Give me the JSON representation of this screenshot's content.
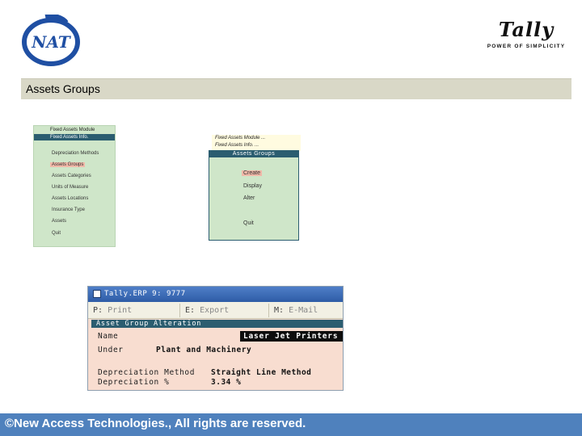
{
  "header": {
    "nat_logo_text": "NAT",
    "tally_logo_text": "Tally",
    "tally_tagline": "POWER OF SIMPLICITY"
  },
  "section_title": "Assets Groups",
  "left_menu": {
    "title": "Fixed Assets Module",
    "bar_label": "Fixed Assets Info.",
    "items": [
      {
        "label": "Depreciation Methods",
        "selected": false
      },
      {
        "label": "Assets Groups",
        "selected": true
      },
      {
        "label": "Assets Categories",
        "selected": false
      },
      {
        "label": "Units of Measure",
        "selected": false
      },
      {
        "label": "Assets Locations",
        "selected": false
      },
      {
        "label": "Insurance Type",
        "selected": false
      },
      {
        "label": "Assets",
        "selected": false
      },
      {
        "label": "Quit",
        "selected": false
      }
    ]
  },
  "mid_menu": {
    "head_lines": [
      "Fixed Assets Module ...",
      "Fixed Assets Info. ..."
    ],
    "bar_label": "Assets Groups",
    "items": [
      {
        "label": "Create",
        "selected": true
      },
      {
        "label": "Display",
        "selected": false
      },
      {
        "label": "Alter",
        "selected": false
      },
      {
        "label": "Quit",
        "selected": false
      }
    ]
  },
  "tally_window": {
    "title": "Tally.ERP 9: 9777",
    "buttons": [
      {
        "key": "P:",
        "label": "Print"
      },
      {
        "key": "E:",
        "label": "Export"
      },
      {
        "key": "M:",
        "label": "E-Mail"
      }
    ],
    "form_title": "Asset Group Alteration",
    "fields": {
      "name_label": "Name",
      "name_value": "Laser Jet Printers",
      "under_label": "Under",
      "under_value": "Plant and Machinery",
      "method_label": "Depreciation Method",
      "method_value": "Straight Line Method",
      "percent_label": "Depreciation %",
      "percent_value": "3.34 %"
    }
  },
  "footer": {
    "text": "©New Access Technologies., All rights are reserved."
  },
  "colors": {
    "title_bar": "#d9d8c7",
    "menu_bg": "#cfe6c9",
    "menu_bar": "#2b5d70",
    "selection": "#f0b8a8",
    "form_bg": "#f8ddd0",
    "footer": "#4f81bd"
  }
}
